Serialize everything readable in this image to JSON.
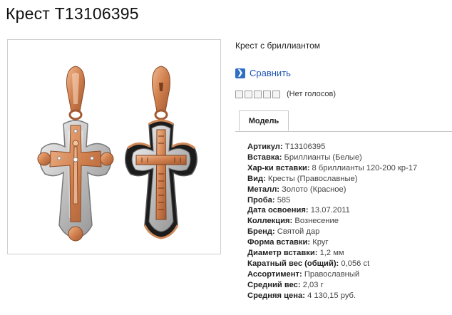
{
  "page": {
    "title": "Крест T13106395"
  },
  "product": {
    "subtitle": "Крест с бриллиантом",
    "compare_label": "Сравнить",
    "rating": {
      "stars_total": 5,
      "stars_filled": 0,
      "votes_label": "(Нет голосов)"
    }
  },
  "tabs": [
    {
      "label": "Модель",
      "active": true
    }
  ],
  "specs": [
    {
      "label": "Артикул:",
      "value": "T13106395"
    },
    {
      "label": "Вставка:",
      "value": "Бриллианты (Белые)"
    },
    {
      "label": "Хар-ки вставки:",
      "value": "8 бриллианты 120-200 кр-17"
    },
    {
      "label": "Вид:",
      "value": "Кресты (Православные)"
    },
    {
      "label": "Металл:",
      "value": "Золото (Красное)"
    },
    {
      "label": "Проба:",
      "value": "585"
    },
    {
      "label": "Дата освоения:",
      "value": "13.07.2011"
    },
    {
      "label": "Коллекция:",
      "value": "Вознесение"
    },
    {
      "label": "Бренд:",
      "value": "Святой дар"
    },
    {
      "label": "Форма вставки:",
      "value": "Круг"
    },
    {
      "label": "Диаметр вставки:",
      "value": "1,2 мм"
    },
    {
      "label": "Каратный вес (общий):",
      "value": "0,056 ct"
    },
    {
      "label": "Ассортимент:",
      "value": "Православный"
    },
    {
      "label": "Средний вес:",
      "value": "2,03 г"
    },
    {
      "label": "Средняя цена:",
      "value": "4 130,15 руб."
    }
  ],
  "colors": {
    "link": "#1f56b3",
    "compare_icon": "#2f6fc4",
    "gold": "#d88a5a",
    "silver": "#b9b9b9",
    "enamel": "#1c1c1c"
  },
  "icons": {
    "compare": "arrow-right-icon",
    "product_image": "cross-pendant-image"
  }
}
